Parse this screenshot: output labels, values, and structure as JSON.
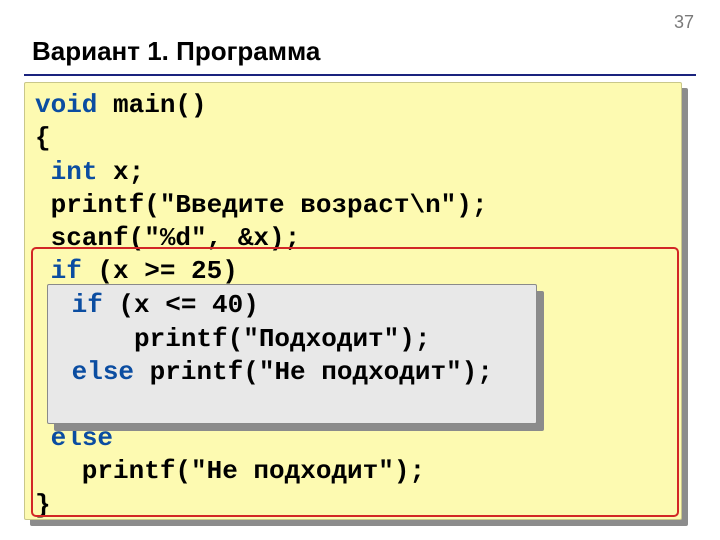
{
  "page_number": "37",
  "title": "Вариант 1. Программа",
  "code_main": {
    "l1_kw": "void",
    "l1_rest": " main()",
    "l2": "{",
    "l3_pad": " ",
    "l3_kw": "int",
    "l3_rest": " x;",
    "l4": " printf(\"Введите возраст\\n\");",
    "l5": " scanf(\"%d\", &x);",
    "l6_pad": " ",
    "l6_kw": "if",
    "l6_rest": " (x >= 25)",
    "l7": " ",
    "l8": " ",
    "l9": " ",
    "l10": " ",
    "l11_pad": " ",
    "l11_kw": "else",
    "l12": "   printf(\"Не подходит\");",
    "l13": "}"
  },
  "code_inner": {
    "l1_pad": " ",
    "l1_kw": "if",
    "l1_rest": " (x <= 40)",
    "l2": "     printf(\"Подходит\");",
    "l3_pad": " ",
    "l3_kw": "else",
    "l3_rest": " printf(\"Не подходит\");"
  }
}
